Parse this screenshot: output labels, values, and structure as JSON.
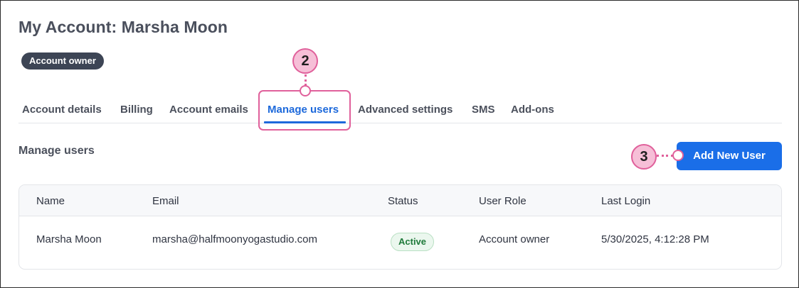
{
  "page": {
    "title": "My Account: Marsha Moon",
    "role_badge": "Account owner"
  },
  "tabs": [
    {
      "label": "Account details"
    },
    {
      "label": "Billing"
    },
    {
      "label": "Account emails"
    },
    {
      "label": "Manage users",
      "active": true
    },
    {
      "label": "Advanced settings"
    },
    {
      "label": "SMS"
    },
    {
      "label": "Add-ons"
    }
  ],
  "section": {
    "title": "Manage users",
    "add_button_label": "Add New User"
  },
  "callouts": {
    "tab_step": "2",
    "button_step": "3"
  },
  "table": {
    "columns": [
      "Name",
      "Email",
      "Status",
      "User Role",
      "Last Login"
    ],
    "rows": [
      {
        "name": "Marsha Moon",
        "email": "marsha@halfmoonyogastudio.com",
        "status": "Active",
        "role": "Account owner",
        "last_login": "5/30/2025, 4:12:28 PM"
      }
    ]
  },
  "colors": {
    "accent_blue": "#1a6ee8",
    "callout_pink": "#e0609b",
    "callout_fill": "#f6bfd7",
    "badge_dark": "#3d4555",
    "status_green": "#1f7a3a"
  }
}
